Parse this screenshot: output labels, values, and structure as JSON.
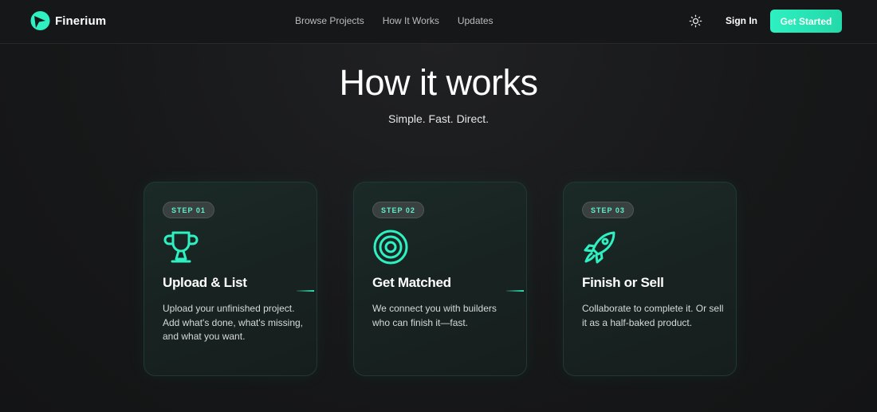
{
  "brand": {
    "name": "Finerium",
    "accent": "#2ef0c1"
  },
  "nav": {
    "links": [
      "Browse Projects",
      "How It Works",
      "Updates"
    ],
    "theme_icon": "sun-icon",
    "sign_in": "Sign In",
    "cta": "Get Started"
  },
  "hero": {
    "title": "How it works",
    "subtitle": "Simple. Fast. Direct."
  },
  "steps": [
    {
      "badge": "STEP 01",
      "icon": "trophy-icon",
      "title": "Upload & List",
      "description": "Upload your unfinished project. Add what's done, what's missing, and what you want."
    },
    {
      "badge": "STEP 02",
      "icon": "target-icon",
      "title": "Get Matched",
      "description": "We connect you with builders who can finish it—fast."
    },
    {
      "badge": "STEP 03",
      "icon": "rocket-icon",
      "title": "Finish or Sell",
      "description": "Collaborate to complete it. Or sell it as a half-baked product."
    }
  ]
}
